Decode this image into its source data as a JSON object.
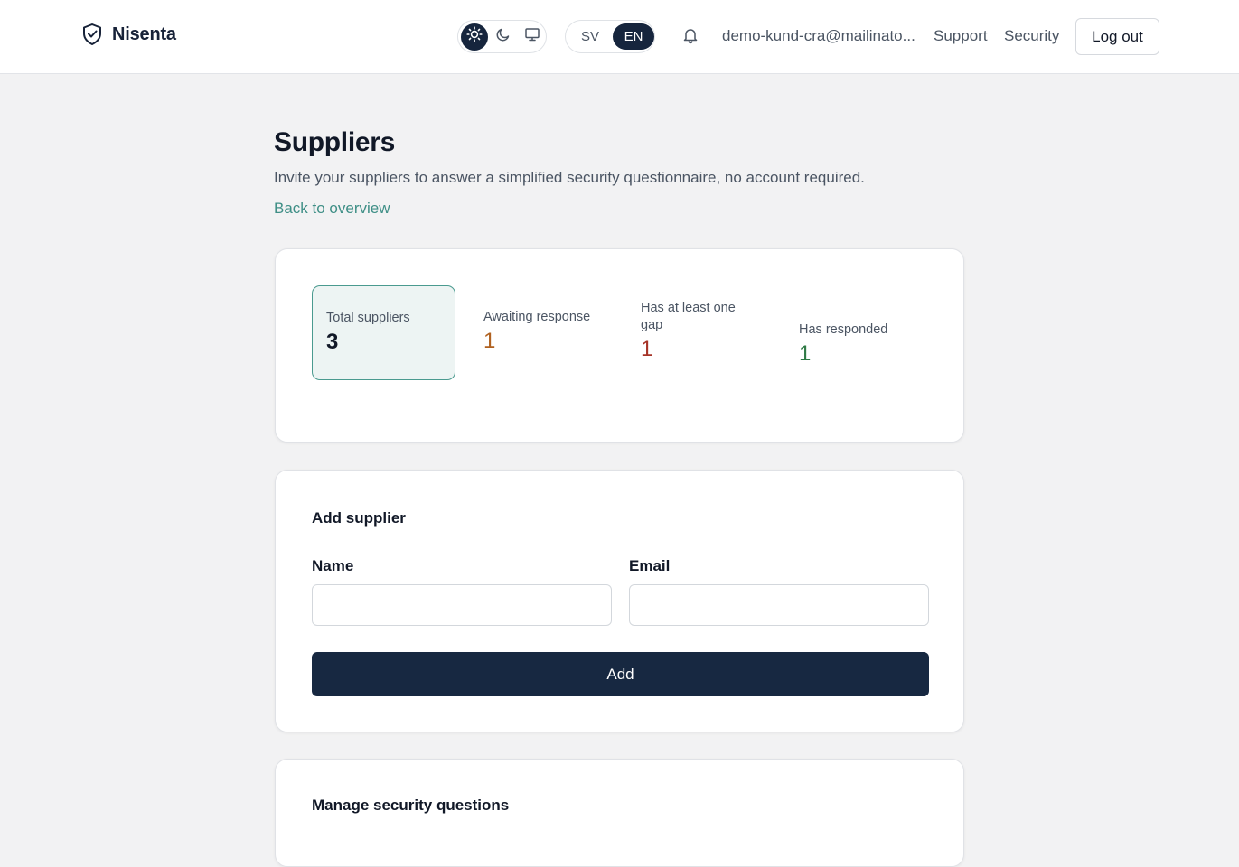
{
  "header": {
    "brand_name": "Nisenta",
    "theme_options": [
      "light",
      "dark",
      "system"
    ],
    "theme_selected": "light",
    "languages": [
      "SV",
      "EN"
    ],
    "language_selected": "EN",
    "user_email": "demo-kund-cra@mailinato...",
    "support_label": "Support",
    "security_label": "Security",
    "logout_label": "Log out"
  },
  "page": {
    "title": "Suppliers",
    "subtitle": "Invite your suppliers to answer a simplified security questionnaire, no account required.",
    "back_link": "Back to overview"
  },
  "stats": {
    "total": {
      "label": "Total suppliers",
      "value": "3"
    },
    "awaiting": {
      "label": "Awaiting response",
      "value": "1"
    },
    "gap": {
      "label": "Has at least one gap",
      "value": "1"
    },
    "responded": {
      "label": "Has responded",
      "value": "1"
    }
  },
  "add_supplier": {
    "title": "Add supplier",
    "name_label": "Name",
    "name_value": "",
    "email_label": "Email",
    "email_value": "",
    "add_label": "Add"
  },
  "manage_questions": {
    "title": "Manage security questions"
  },
  "colors": {
    "accent": "#3f8f86",
    "primary_dark": "#172841",
    "awaiting": "#b0611f",
    "gap": "#a63327",
    "responded": "#2f7a45"
  }
}
